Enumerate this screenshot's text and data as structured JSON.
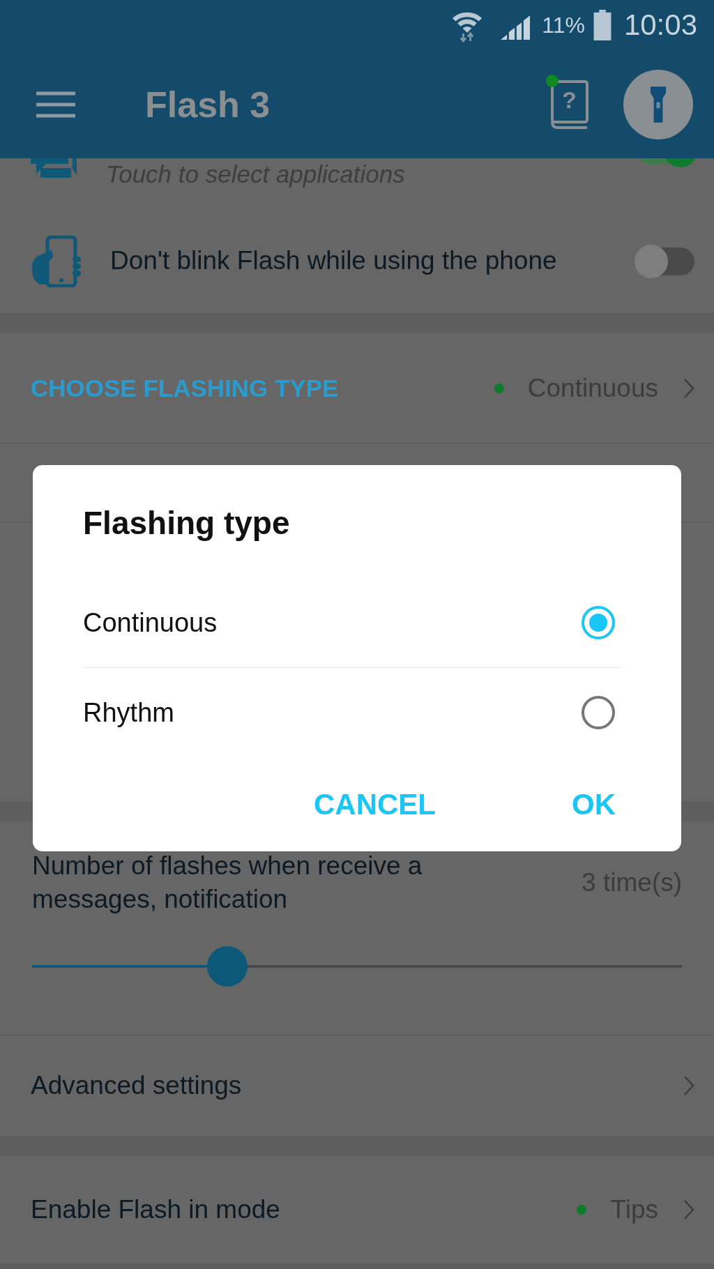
{
  "status_bar": {
    "battery": "11%",
    "time": "10:03"
  },
  "app_bar": {
    "title": "Flash 3",
    "help_glyph": "?"
  },
  "cards": [
    {
      "rows": [
        {
          "kind": "toggle",
          "subtitle": "Touch to select applications",
          "on": true
        },
        {
          "kind": "toggle",
          "title": "Don't blink Flash while using the phone",
          "on": false
        }
      ]
    },
    {
      "rows": [
        {
          "kind": "header_choice",
          "title": "CHOOSE FLASHING TYPE",
          "value": "Continuous"
        }
      ]
    },
    {
      "rows": [
        {
          "kind": "slider",
          "title": "Number of flashes when receive a messages, notification",
          "reading": "3 time(s)",
          "level": 0.3
        },
        {
          "kind": "link",
          "title": "Advanced settings"
        }
      ]
    },
    {
      "rows": [
        {
          "kind": "choice",
          "title": "Enable Flash in mode",
          "value": "Tips"
        }
      ]
    }
  ],
  "dialog": {
    "title": "Flashing type",
    "options": [
      {
        "label": "Continuous",
        "selected": true
      },
      {
        "label": "Rhythm",
        "selected": false
      }
    ],
    "buttons": [
      "CANCEL",
      "OK"
    ]
  }
}
